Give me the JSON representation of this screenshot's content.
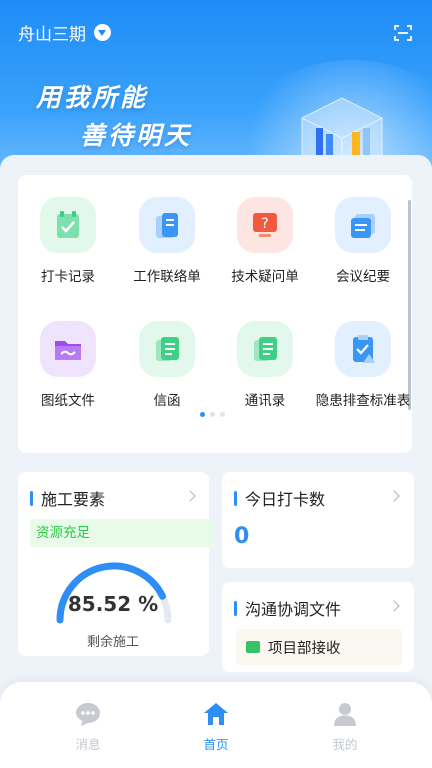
{
  "header": {
    "location": "舟山三期",
    "slogan_line1": "用我所能",
    "slogan_line2": "善待明天"
  },
  "grid": {
    "tiles": [
      {
        "label": "打卡记录",
        "icon": "checkin-icon",
        "color": "#3fcf85"
      },
      {
        "label": "工作联络单",
        "icon": "contact-sheet-icon",
        "color": "#3b95f4"
      },
      {
        "label": "技术疑问单",
        "icon": "question-screen-icon",
        "color": "#f25a3e"
      },
      {
        "label": "会议纪要",
        "icon": "meeting-minutes-icon",
        "color": "#3b95f4"
      },
      {
        "label": "图纸文件",
        "icon": "drawing-folder-icon",
        "color": "#9c4ff0"
      },
      {
        "label": "信函",
        "icon": "letter-icon",
        "color": "#3fcf85"
      },
      {
        "label": "通讯录",
        "icon": "address-book-icon",
        "color": "#3fcf85"
      },
      {
        "label": "隐患排查标准表",
        "icon": "hazard-checklist-icon",
        "color": "#3b95f4"
      }
    ],
    "page_count": 3,
    "page_index": 0
  },
  "construction": {
    "title": "施工要素",
    "status": "资源充足",
    "percent_text": "85.52 %",
    "percent_value": 85.52,
    "caption": "剩余施工"
  },
  "checkin": {
    "title": "今日打卡数",
    "count": "0"
  },
  "comms": {
    "title": "沟通协调文件",
    "item": "项目部接收"
  },
  "tabbar": {
    "tabs": [
      {
        "label": "消息",
        "icon": "message-icon",
        "active": false
      },
      {
        "label": "首页",
        "icon": "home-icon",
        "active": true
      },
      {
        "label": "我的",
        "icon": "profile-icon",
        "active": false
      }
    ]
  },
  "colors": {
    "accent": "#2f8ef5",
    "success": "#31c74a",
    "hero_top": "#1e8cf7"
  }
}
